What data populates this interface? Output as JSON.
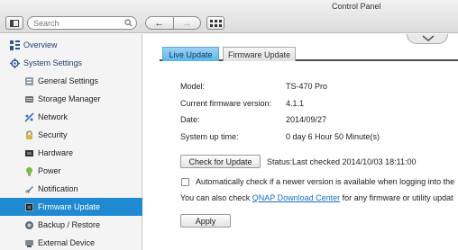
{
  "window": {
    "title": "Control Panel"
  },
  "toolbar": {
    "search_placeholder": "Search",
    "back_glyph": "←",
    "forward_glyph": "→"
  },
  "sidebar": {
    "overview": "Overview",
    "system_settings": "System Settings",
    "items": [
      {
        "label": "General Settings",
        "icon": "general-settings-icon"
      },
      {
        "label": "Storage Manager",
        "icon": "storage-icon"
      },
      {
        "label": "Network",
        "icon": "network-icon"
      },
      {
        "label": "Security",
        "icon": "lock-icon"
      },
      {
        "label": "Hardware",
        "icon": "hardware-icon"
      },
      {
        "label": "Power",
        "icon": "power-icon"
      },
      {
        "label": "Notification",
        "icon": "notification-icon"
      },
      {
        "label": "Firmware Update",
        "icon": "firmware-icon",
        "active": true
      },
      {
        "label": "Backup / Restore",
        "icon": "backup-icon"
      },
      {
        "label": "External Device",
        "icon": "external-device-icon"
      }
    ]
  },
  "tabs": [
    {
      "label": "Live Update",
      "active": true
    },
    {
      "label": "Firmware Update",
      "active": false
    }
  ],
  "info": {
    "model_label": "Model:",
    "model_value": "TS-470 Pro",
    "fw_label": "Current firmware version:",
    "fw_value": "4.1.1",
    "date_label": "Date:",
    "date_value": "2014/09/27",
    "uptime_label": "System up time:",
    "uptime_value": "0 day 6 Hour 50 Minute(s)"
  },
  "update": {
    "check_button": "Check for Update",
    "status": "Status:Last checked 2014/10/03 18:11:00",
    "auto_check_label": "Automatically check if a newer version is available when logging into the",
    "auto_check_checked": false,
    "also_prefix": "You can also check ",
    "also_link": "QNAP Download Center",
    "also_suffix": " for any firmware or utility updat",
    "apply_button": "Apply"
  },
  "colors": {
    "accent": "#1f8ad2",
    "tab_active": "#5cb4ea",
    "link": "#1a6fc4"
  }
}
